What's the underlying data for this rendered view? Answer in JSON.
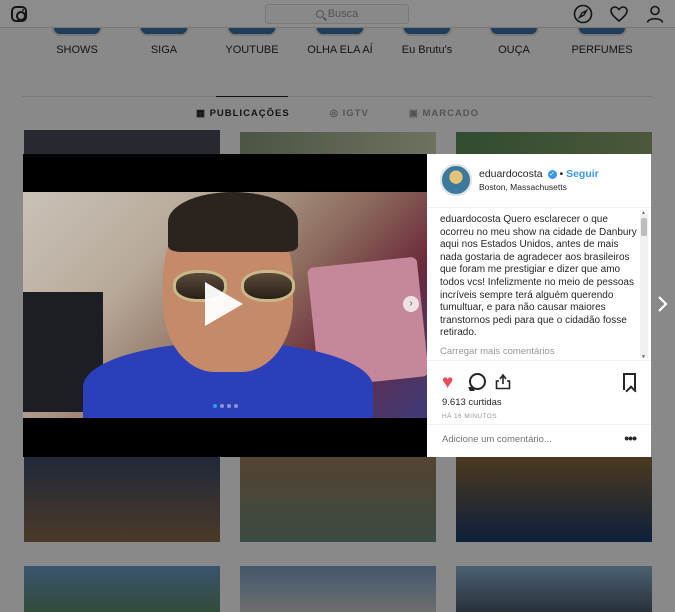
{
  "search": {
    "placeholder": "Busca"
  },
  "highlights": [
    "SHOWS",
    "SIGA",
    "YOUTUBE",
    "OLHA ELA AÍ",
    "Eu Brutu's",
    "OUÇA",
    "PERFUMES"
  ],
  "tabs": {
    "publicacoes": "PUBLICAÇÕES",
    "igtv": "IGTV",
    "marcado": "MARCADO"
  },
  "post": {
    "username": "eduardocosta",
    "verified_mark": "✓",
    "separator": "•",
    "follow_label": "Seguir",
    "location": "Boston, Massachusetts",
    "caption_user": "eduardocosta",
    "caption_text": "Quero esclarecer o que ocorreu no meu show na cidade de Danbury aqui nos Estados Unidos, antes de mais nada gostaria de agradecer aos brasileiros que foram me prestigiar e dizer que amo todos vcs! Infelizmente no meio de pessoas incríveis sempre terá alguém querendo tumultuar, e para não causar maiores transtornos pedi para que o cidadão fosse retirado.",
    "load_more": "Carregar mais comentários",
    "likes": "9.613 curtidas",
    "time": "HÁ 16 MINUTOS",
    "comment_placeholder": "Adicione um comentário...",
    "more": "•••",
    "carousel_next": "›"
  },
  "icons": {
    "heart": "♥"
  },
  "colors": {
    "accent": "#3897f0",
    "like": "#ed4956"
  }
}
